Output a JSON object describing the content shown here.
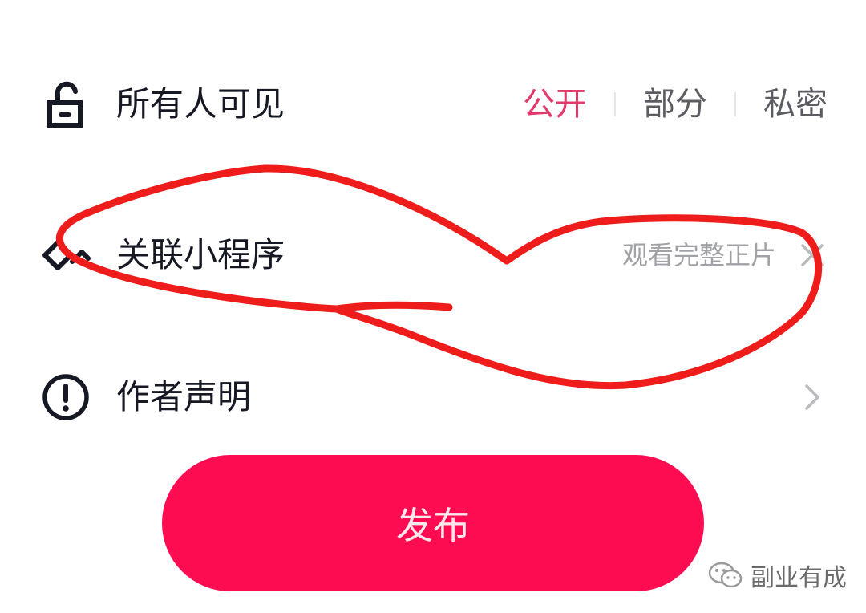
{
  "visibility": {
    "label": "所有人可见",
    "options": [
      "公开",
      "部分",
      "私密"
    ],
    "selected": "公开"
  },
  "mini_program": {
    "label": "关联小程序",
    "value": "观看完整正片"
  },
  "author_statement": {
    "label": "作者声明"
  },
  "publish_button": {
    "label": "发布"
  },
  "watermark": {
    "text": "副业有成"
  },
  "colors": {
    "accent": "#fe0c52",
    "active_option": "#e13a6a",
    "annotation": "#ef1c1c"
  }
}
